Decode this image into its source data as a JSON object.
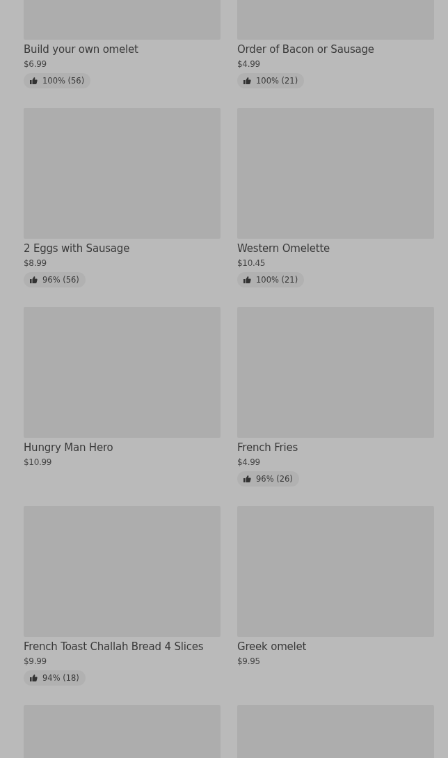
{
  "items": [
    {
      "kind": "dish",
      "name": "Build your own omelet",
      "price": "$6.99",
      "rating": "100% (56)"
    },
    {
      "kind": "dish",
      "name": "Order of Bacon or Sausage",
      "price": "$4.99",
      "rating": "100% (21)"
    },
    {
      "kind": "dish",
      "name": "2 Eggs with Sausage",
      "price": "$8.99",
      "rating": "96% (56)"
    },
    {
      "kind": "dish",
      "name": "Western Omelette",
      "price": "$10.45",
      "rating": "100% (21)"
    },
    {
      "kind": "dish",
      "name": "Hungry Man Hero",
      "price": "$10.99"
    },
    {
      "kind": "dish",
      "name": "French Fries",
      "price": "$4.99",
      "rating": "96% (26)"
    },
    {
      "kind": "dish",
      "name": "French Toast Challah Bread 4 Slices",
      "price": "$9.99",
      "rating": "94% (18)"
    },
    {
      "kind": "dish",
      "name": "Greek omelet",
      "price": "$9.95"
    },
    {
      "kind": "image_only"
    },
    {
      "kind": "image_only"
    }
  ]
}
